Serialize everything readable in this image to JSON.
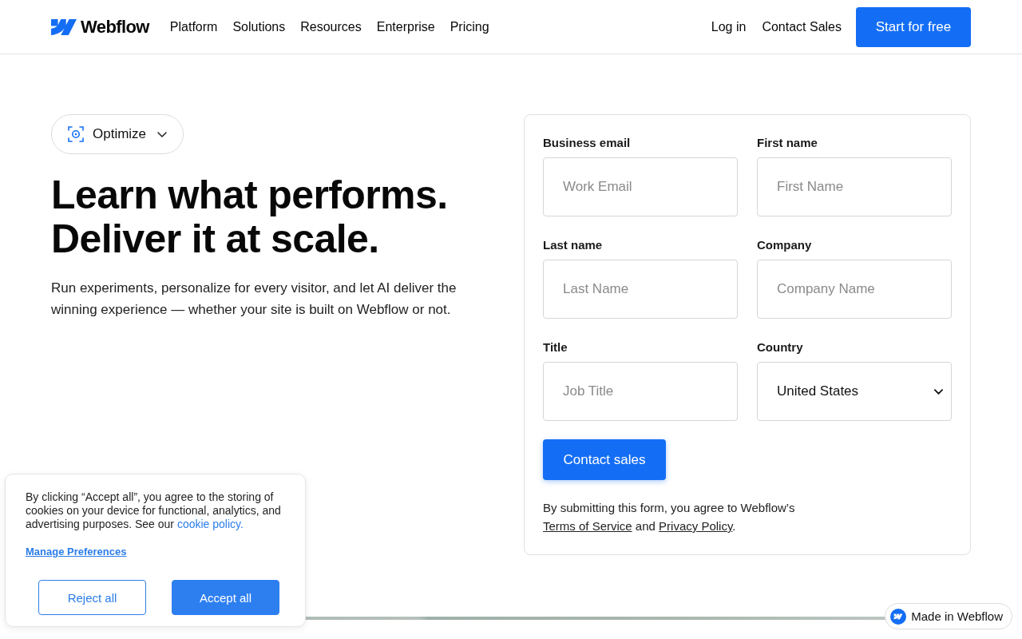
{
  "header": {
    "logo": "Webflow",
    "nav": [
      "Platform",
      "Solutions",
      "Resources",
      "Enterprise",
      "Pricing"
    ],
    "actions": [
      {
        "kind": "link",
        "label": "Log in"
      },
      {
        "kind": "link",
        "label": "Contact Sales"
      },
      {
        "kind": "button",
        "label": "Start for free"
      }
    ]
  },
  "hero": {
    "category": {
      "label": "Optimize"
    },
    "headline_lines": [
      "Learn what performs.",
      "Deliver it at scale."
    ],
    "description": "Run experiments, personalize for every visitor, and let AI deliver the winning experience — whether your site is built on Webflow or not."
  },
  "form": {
    "fields": [
      {
        "kind": "input",
        "label": "Business email",
        "placeholder": "Work Email"
      },
      {
        "kind": "input",
        "label": "First name",
        "placeholder": "First Name"
      },
      {
        "kind": "input",
        "label": "Last name",
        "placeholder": "Last Name"
      },
      {
        "kind": "input",
        "label": "Company",
        "placeholder": "Company Name"
      },
      {
        "kind": "input",
        "label": "Title",
        "placeholder": "Job Title"
      },
      {
        "kind": "select",
        "label": "Country",
        "value": "United States"
      }
    ],
    "submit": "Contact sales",
    "legal": [
      {
        "kind": "text",
        "text": "By submitting this form, you agree to Webflow’s "
      },
      {
        "kind": "link",
        "text": "Terms of Service"
      },
      {
        "kind": "text",
        "text": " and "
      },
      {
        "kind": "link",
        "text": "Privacy Policy"
      },
      {
        "kind": "text",
        "text": "."
      }
    ]
  },
  "cookie_banner": {
    "message": [
      {
        "kind": "text",
        "text": "By clicking “Accept all”, you agree to the storing of cookies on your device for functional, analytics, and advertising purposes. See our "
      },
      {
        "kind": "link",
        "text": "cookie policy."
      }
    ],
    "manage_link": "Manage Preferences",
    "buttons": [
      {
        "kind": "secondary",
        "label": "Reject all"
      },
      {
        "kind": "primary",
        "label": "Accept all"
      }
    ]
  },
  "badge": {
    "label": "Made in Webflow"
  }
}
